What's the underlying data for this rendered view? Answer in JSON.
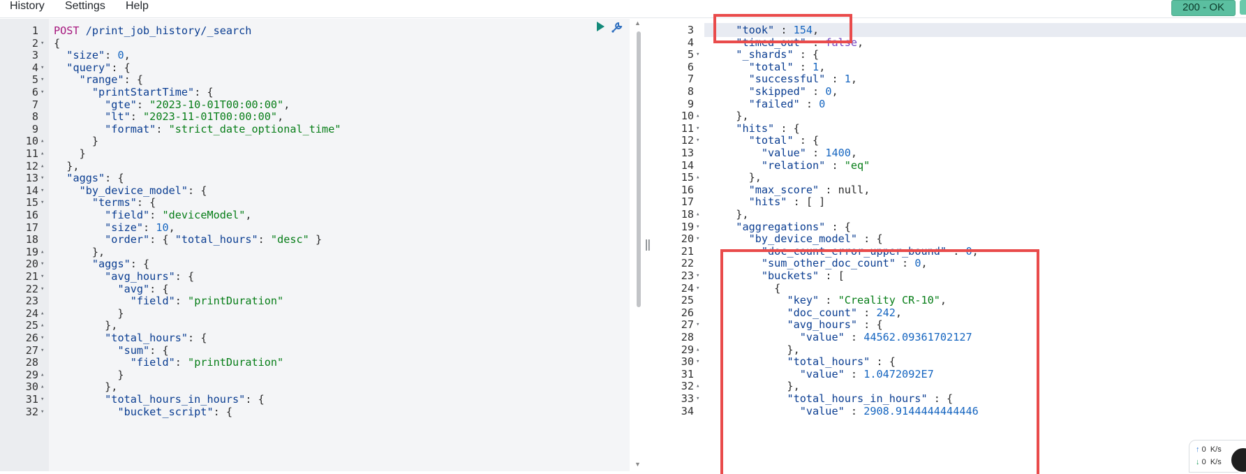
{
  "menu": {
    "history": "History",
    "settings": "Settings",
    "help": "Help"
  },
  "status": {
    "label": "200 - OK",
    "color": "#5bbfa0"
  },
  "icons": {
    "run": "play-icon",
    "settings": "wrench-icon",
    "splitter": "drag-handle-icon"
  },
  "splitter_glyph": "‖",
  "request": {
    "lines": [
      {
        "n": "1",
        "fold": "",
        "tokens": [
          [
            "m",
            "POST "
          ],
          [
            "k",
            "/print_job_history/_search"
          ]
        ]
      },
      {
        "n": "2",
        "fold": "▾",
        "tokens": [
          [
            "p",
            "{"
          ]
        ]
      },
      {
        "n": "3",
        "fold": "",
        "tokens": [
          [
            "p",
            "  "
          ],
          [
            "k",
            "\"size\""
          ],
          [
            "p",
            ": "
          ],
          [
            "n",
            "0"
          ],
          [
            "p",
            ","
          ]
        ]
      },
      {
        "n": "4",
        "fold": "▾",
        "tokens": [
          [
            "p",
            "  "
          ],
          [
            "k",
            "\"query\""
          ],
          [
            "p",
            ": {"
          ]
        ]
      },
      {
        "n": "5",
        "fold": "▾",
        "tokens": [
          [
            "p",
            "    "
          ],
          [
            "k",
            "\"range\""
          ],
          [
            "p",
            ": {"
          ]
        ]
      },
      {
        "n": "6",
        "fold": "▾",
        "tokens": [
          [
            "p",
            "      "
          ],
          [
            "k",
            "\"printStartTime\""
          ],
          [
            "p",
            ": {"
          ]
        ]
      },
      {
        "n": "7",
        "fold": "",
        "tokens": [
          [
            "p",
            "        "
          ],
          [
            "k",
            "\"gte\""
          ],
          [
            "p",
            ": "
          ],
          [
            "s",
            "\"2023-10-01T00:00:00\""
          ],
          [
            "p",
            ","
          ]
        ]
      },
      {
        "n": "8",
        "fold": "",
        "tokens": [
          [
            "p",
            "        "
          ],
          [
            "k",
            "\"lt\""
          ],
          [
            "p",
            ": "
          ],
          [
            "s",
            "\"2023-11-01T00:00:00\""
          ],
          [
            "p",
            ","
          ]
        ]
      },
      {
        "n": "9",
        "fold": "",
        "tokens": [
          [
            "p",
            "        "
          ],
          [
            "k",
            "\"format\""
          ],
          [
            "p",
            ": "
          ],
          [
            "s",
            "\"strict_date_optional_time\""
          ]
        ]
      },
      {
        "n": "10",
        "fold": "▴",
        "tokens": [
          [
            "p",
            "      }"
          ]
        ]
      },
      {
        "n": "11",
        "fold": "▴",
        "tokens": [
          [
            "p",
            "    }"
          ]
        ]
      },
      {
        "n": "12",
        "fold": "▴",
        "tokens": [
          [
            "p",
            "  },"
          ]
        ]
      },
      {
        "n": "13",
        "fold": "▾",
        "tokens": [
          [
            "p",
            "  "
          ],
          [
            "k",
            "\"aggs\""
          ],
          [
            "p",
            ": {"
          ]
        ]
      },
      {
        "n": "14",
        "fold": "▾",
        "tokens": [
          [
            "p",
            "    "
          ],
          [
            "k",
            "\"by_device_model\""
          ],
          [
            "p",
            ": {"
          ]
        ]
      },
      {
        "n": "15",
        "fold": "▾",
        "tokens": [
          [
            "p",
            "      "
          ],
          [
            "k",
            "\"terms\""
          ],
          [
            "p",
            ": {"
          ]
        ]
      },
      {
        "n": "16",
        "fold": "",
        "tokens": [
          [
            "p",
            "        "
          ],
          [
            "k",
            "\"field\""
          ],
          [
            "p",
            ": "
          ],
          [
            "s",
            "\"deviceModel\""
          ],
          [
            "p",
            ","
          ]
        ]
      },
      {
        "n": "17",
        "fold": "",
        "tokens": [
          [
            "p",
            "        "
          ],
          [
            "k",
            "\"size\""
          ],
          [
            "p",
            ": "
          ],
          [
            "n",
            "10"
          ],
          [
            "p",
            ","
          ]
        ]
      },
      {
        "n": "18",
        "fold": "",
        "tokens": [
          [
            "p",
            "        "
          ],
          [
            "k",
            "\"order\""
          ],
          [
            "p",
            ": { "
          ],
          [
            "k",
            "\"total_hours\""
          ],
          [
            "p",
            ": "
          ],
          [
            "s",
            "\"desc\""
          ],
          [
            "p",
            " }"
          ]
        ]
      },
      {
        "n": "19",
        "fold": "▴",
        "tokens": [
          [
            "p",
            "      },"
          ]
        ]
      },
      {
        "n": "20",
        "fold": "▾",
        "tokens": [
          [
            "p",
            "      "
          ],
          [
            "k",
            "\"aggs\""
          ],
          [
            "p",
            ": {"
          ]
        ]
      },
      {
        "n": "21",
        "fold": "▾",
        "tokens": [
          [
            "p",
            "        "
          ],
          [
            "k",
            "\"avg_hours\""
          ],
          [
            "p",
            ": {"
          ]
        ]
      },
      {
        "n": "22",
        "fold": "▾",
        "tokens": [
          [
            "p",
            "          "
          ],
          [
            "k",
            "\"avg\""
          ],
          [
            "p",
            ": {"
          ]
        ]
      },
      {
        "n": "23",
        "fold": "",
        "tokens": [
          [
            "p",
            "            "
          ],
          [
            "k",
            "\"field\""
          ],
          [
            "p",
            ": "
          ],
          [
            "s",
            "\"printDuration\""
          ]
        ]
      },
      {
        "n": "24",
        "fold": "▴",
        "tokens": [
          [
            "p",
            "          }"
          ]
        ]
      },
      {
        "n": "25",
        "fold": "▴",
        "tokens": [
          [
            "p",
            "        },"
          ]
        ]
      },
      {
        "n": "26",
        "fold": "▾",
        "tokens": [
          [
            "p",
            "        "
          ],
          [
            "k",
            "\"total_hours\""
          ],
          [
            "p",
            ": {"
          ]
        ]
      },
      {
        "n": "27",
        "fold": "▾",
        "tokens": [
          [
            "p",
            "          "
          ],
          [
            "k",
            "\"sum\""
          ],
          [
            "p",
            ": {"
          ]
        ]
      },
      {
        "n": "28",
        "fold": "",
        "tokens": [
          [
            "p",
            "            "
          ],
          [
            "k",
            "\"field\""
          ],
          [
            "p",
            ": "
          ],
          [
            "s",
            "\"printDuration\""
          ]
        ]
      },
      {
        "n": "29",
        "fold": "▴",
        "tokens": [
          [
            "p",
            "          }"
          ]
        ]
      },
      {
        "n": "30",
        "fold": "▴",
        "tokens": [
          [
            "p",
            "        },"
          ]
        ]
      },
      {
        "n": "31",
        "fold": "▾",
        "tokens": [
          [
            "p",
            "        "
          ],
          [
            "k",
            "\"total_hours_in_hours\""
          ],
          [
            "p",
            ": {"
          ]
        ]
      },
      {
        "n": "32",
        "fold": "▾",
        "tokens": [
          [
            "p",
            "          "
          ],
          [
            "k",
            "\"bucket_script\""
          ],
          [
            "p",
            ": {"
          ]
        ]
      }
    ]
  },
  "response": {
    "lines": [
      {
        "n": "3",
        "fold": "",
        "tokens": [
          [
            "p",
            "  "
          ],
          [
            "k",
            "\"took\""
          ],
          [
            "p",
            " : "
          ],
          [
            "n",
            "154"
          ],
          [
            "p",
            ","
          ]
        ]
      },
      {
        "n": "4",
        "fold": "",
        "tokens": [
          [
            "p",
            "  "
          ],
          [
            "k",
            "\"timed_out\""
          ],
          [
            "p",
            " : "
          ],
          [
            "b",
            "false"
          ],
          [
            "p",
            ","
          ]
        ]
      },
      {
        "n": "5",
        "fold": "▾",
        "tokens": [
          [
            "p",
            "  "
          ],
          [
            "k",
            "\"_shards\""
          ],
          [
            "p",
            " : {"
          ]
        ]
      },
      {
        "n": "6",
        "fold": "",
        "tokens": [
          [
            "p",
            "    "
          ],
          [
            "k",
            "\"total\""
          ],
          [
            "p",
            " : "
          ],
          [
            "n",
            "1"
          ],
          [
            "p",
            ","
          ]
        ]
      },
      {
        "n": "7",
        "fold": "",
        "tokens": [
          [
            "p",
            "    "
          ],
          [
            "k",
            "\"successful\""
          ],
          [
            "p",
            " : "
          ],
          [
            "n",
            "1"
          ],
          [
            "p",
            ","
          ]
        ]
      },
      {
        "n": "8",
        "fold": "",
        "tokens": [
          [
            "p",
            "    "
          ],
          [
            "k",
            "\"skipped\""
          ],
          [
            "p",
            " : "
          ],
          [
            "n",
            "0"
          ],
          [
            "p",
            ","
          ]
        ]
      },
      {
        "n": "9",
        "fold": "",
        "tokens": [
          [
            "p",
            "    "
          ],
          [
            "k",
            "\"failed\""
          ],
          [
            "p",
            " : "
          ],
          [
            "n",
            "0"
          ]
        ]
      },
      {
        "n": "10",
        "fold": "▴",
        "tokens": [
          [
            "p",
            "  },"
          ]
        ]
      },
      {
        "n": "11",
        "fold": "▾",
        "tokens": [
          [
            "p",
            "  "
          ],
          [
            "k",
            "\"hits\""
          ],
          [
            "p",
            " : {"
          ]
        ]
      },
      {
        "n": "12",
        "fold": "▾",
        "tokens": [
          [
            "p",
            "    "
          ],
          [
            "k",
            "\"total\""
          ],
          [
            "p",
            " : {"
          ]
        ]
      },
      {
        "n": "13",
        "fold": "",
        "tokens": [
          [
            "p",
            "      "
          ],
          [
            "k",
            "\"value\""
          ],
          [
            "p",
            " : "
          ],
          [
            "n",
            "1400"
          ],
          [
            "p",
            ","
          ]
        ]
      },
      {
        "n": "14",
        "fold": "",
        "tokens": [
          [
            "p",
            "      "
          ],
          [
            "k",
            "\"relation\""
          ],
          [
            "p",
            " : "
          ],
          [
            "s",
            "\"eq\""
          ]
        ]
      },
      {
        "n": "15",
        "fold": "▴",
        "tokens": [
          [
            "p",
            "    },"
          ]
        ]
      },
      {
        "n": "16",
        "fold": "",
        "tokens": [
          [
            "p",
            "    "
          ],
          [
            "k",
            "\"max_score\""
          ],
          [
            "p",
            " : "
          ],
          [
            "p",
            "null"
          ],
          [
            "p",
            ","
          ]
        ]
      },
      {
        "n": "17",
        "fold": "",
        "tokens": [
          [
            "p",
            "    "
          ],
          [
            "k",
            "\"hits\""
          ],
          [
            "p",
            " : [ ]"
          ]
        ]
      },
      {
        "n": "18",
        "fold": "▴",
        "tokens": [
          [
            "p",
            "  },"
          ]
        ]
      },
      {
        "n": "19",
        "fold": "▾",
        "tokens": [
          [
            "p",
            "  "
          ],
          [
            "k",
            "\"aggregations\""
          ],
          [
            "p",
            " : {"
          ]
        ]
      },
      {
        "n": "20",
        "fold": "▾",
        "tokens": [
          [
            "p",
            "    "
          ],
          [
            "k",
            "\"by_device_model\""
          ],
          [
            "p",
            " : {"
          ]
        ]
      },
      {
        "n": "21",
        "fold": "",
        "tokens": [
          [
            "p",
            "      "
          ],
          [
            "k",
            "\"doc_count_error_upper_bound\""
          ],
          [
            "p",
            " : "
          ],
          [
            "n",
            "0"
          ],
          [
            "p",
            ","
          ]
        ]
      },
      {
        "n": "22",
        "fold": "",
        "tokens": [
          [
            "p",
            "      "
          ],
          [
            "k",
            "\"sum_other_doc_count\""
          ],
          [
            "p",
            " : "
          ],
          [
            "n",
            "0"
          ],
          [
            "p",
            ","
          ]
        ]
      },
      {
        "n": "23",
        "fold": "▾",
        "tokens": [
          [
            "p",
            "      "
          ],
          [
            "k",
            "\"buckets\""
          ],
          [
            "p",
            " : ["
          ]
        ]
      },
      {
        "n": "24",
        "fold": "▾",
        "tokens": [
          [
            "p",
            "        {"
          ]
        ]
      },
      {
        "n": "25",
        "fold": "",
        "tokens": [
          [
            "p",
            "          "
          ],
          [
            "k",
            "\"key\""
          ],
          [
            "p",
            " : "
          ],
          [
            "s",
            "\"Creality CR-10\""
          ],
          [
            "p",
            ","
          ]
        ]
      },
      {
        "n": "26",
        "fold": "",
        "tokens": [
          [
            "p",
            "          "
          ],
          [
            "k",
            "\"doc_count\""
          ],
          [
            "p",
            " : "
          ],
          [
            "n",
            "242"
          ],
          [
            "p",
            ","
          ]
        ]
      },
      {
        "n": "27",
        "fold": "▾",
        "tokens": [
          [
            "p",
            "          "
          ],
          [
            "k",
            "\"avg_hours\""
          ],
          [
            "p",
            " : {"
          ]
        ]
      },
      {
        "n": "28",
        "fold": "",
        "tokens": [
          [
            "p",
            "            "
          ],
          [
            "k",
            "\"value\""
          ],
          [
            "p",
            " : "
          ],
          [
            "n",
            "44562.09361702127"
          ]
        ]
      },
      {
        "n": "29",
        "fold": "▴",
        "tokens": [
          [
            "p",
            "          },"
          ]
        ]
      },
      {
        "n": "30",
        "fold": "▾",
        "tokens": [
          [
            "p",
            "          "
          ],
          [
            "k",
            "\"total_hours\""
          ],
          [
            "p",
            " : {"
          ]
        ]
      },
      {
        "n": "31",
        "fold": "",
        "tokens": [
          [
            "p",
            "            "
          ],
          [
            "k",
            "\"value\""
          ],
          [
            "p",
            " : "
          ],
          [
            "n",
            "1.0472092E7"
          ]
        ]
      },
      {
        "n": "32",
        "fold": "▴",
        "tokens": [
          [
            "p",
            "          },"
          ]
        ]
      },
      {
        "n": "33",
        "fold": "▾",
        "tokens": [
          [
            "p",
            "          "
          ],
          [
            "k",
            "\"total_hours_in_hours\""
          ],
          [
            "p",
            " : {"
          ]
        ]
      },
      {
        "n": "34",
        "fold": "",
        "tokens": [
          [
            "p",
            "            "
          ],
          [
            "k",
            "\"value\""
          ],
          [
            "p",
            " : "
          ],
          [
            "n",
            "2908.9144444444446"
          ]
        ]
      }
    ]
  },
  "network": {
    "up": "0",
    "down": "0",
    "unit": "K/s"
  }
}
